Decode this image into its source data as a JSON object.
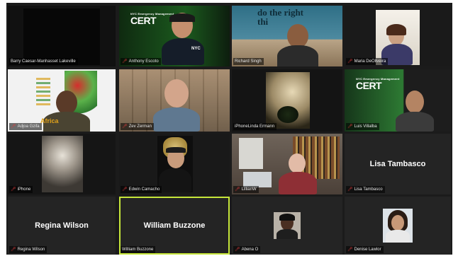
{
  "participants": [
    {
      "name": "Barry Caesar-Manhasset Lakeville"
    },
    {
      "name": "Anthony Escoto"
    },
    {
      "name": "Richard Singh"
    },
    {
      "name": "Maria DeOliveira"
    },
    {
      "name": "Adjoa Gzifa"
    },
    {
      "name": "Zev Zerman"
    },
    {
      "name": "iPhoneLinda Ermann"
    },
    {
      "name": "Luis Villalba"
    },
    {
      "name": "iPhone"
    },
    {
      "name": "Edwin Camacho"
    },
    {
      "name": "LillianW"
    },
    {
      "name": "Lisa Tambasco",
      "display_name": "Lisa Tambasco"
    },
    {
      "name": "Regina Wilson",
      "display_name": "Regina Wilson"
    },
    {
      "name": "William Buzzone",
      "display_name": "William Buzzone"
    },
    {
      "name": "Abena O"
    },
    {
      "name": "Denise Lawlor"
    }
  ],
  "logos": {
    "cert_top": "NYC Emergency Management",
    "cert_big": "CERT",
    "nyc_shirt": "NYC"
  },
  "backgrounds": {
    "richard_slogan": "do the right thi",
    "adjoa_map": "Africa"
  },
  "colors": {
    "mic_muted": "#e03b3b",
    "active_speaker_border": "#c6e63a",
    "tile_bg": "#2a2a2a",
    "cert_green": "#58b342"
  }
}
